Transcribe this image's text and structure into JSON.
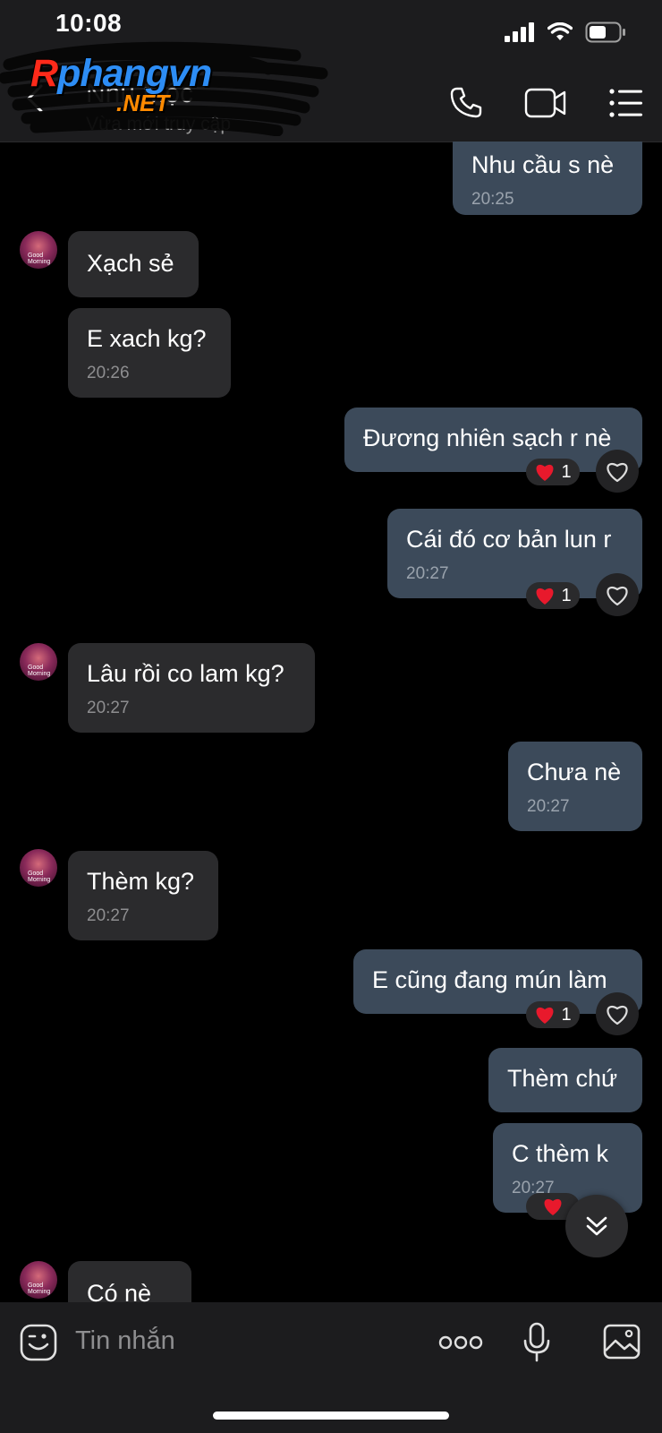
{
  "status_bar": {
    "time": "10:08"
  },
  "header": {
    "contact_name": "Nhu Mộc",
    "contact_status": "Vừa mới truy cập",
    "watermark": {
      "brand": "Rphangvn",
      "brand_first": "R",
      "brand_rest": "phangvn",
      "suffix": ".NET"
    }
  },
  "messages": [
    {
      "direction": "out",
      "text": "Nhu cầu s nè",
      "time": "20:25"
    },
    {
      "direction": "in",
      "text": "Xạch sẻ"
    },
    {
      "direction": "in",
      "text": "E xach kg?",
      "time": "20:26"
    },
    {
      "direction": "out",
      "text": "Đương nhiên sạch r nè",
      "reaction": {
        "emoji": "heart",
        "count": "1"
      }
    },
    {
      "direction": "out",
      "text": "Cái đó cơ bản lun r",
      "time": "20:27",
      "reaction": {
        "emoji": "heart",
        "count": "1"
      }
    },
    {
      "direction": "in",
      "text": "Lâu rồi co lam kg?",
      "time": "20:27"
    },
    {
      "direction": "out",
      "text": "Chưa nè",
      "time": "20:27"
    },
    {
      "direction": "in",
      "text": "Thèm kg?",
      "time": "20:27"
    },
    {
      "direction": "out",
      "text": "E cũng đang mún làm",
      "reaction": {
        "emoji": "heart",
        "count": "1"
      }
    },
    {
      "direction": "out",
      "text": "Thèm chứ"
    },
    {
      "direction": "out",
      "text": "C thèm k",
      "time": "20:27",
      "reaction": {
        "emoji": "heart"
      }
    },
    {
      "direction": "in",
      "text": "Có nè"
    }
  ],
  "avatar_caption": "Good Morning",
  "composer": {
    "placeholder": "Tin nhắn"
  },
  "colors": {
    "outgoing_bubble": "#3c4a5a",
    "incoming_bubble": "#2b2b2d",
    "background": "#000000",
    "heart": "#e8192c"
  }
}
